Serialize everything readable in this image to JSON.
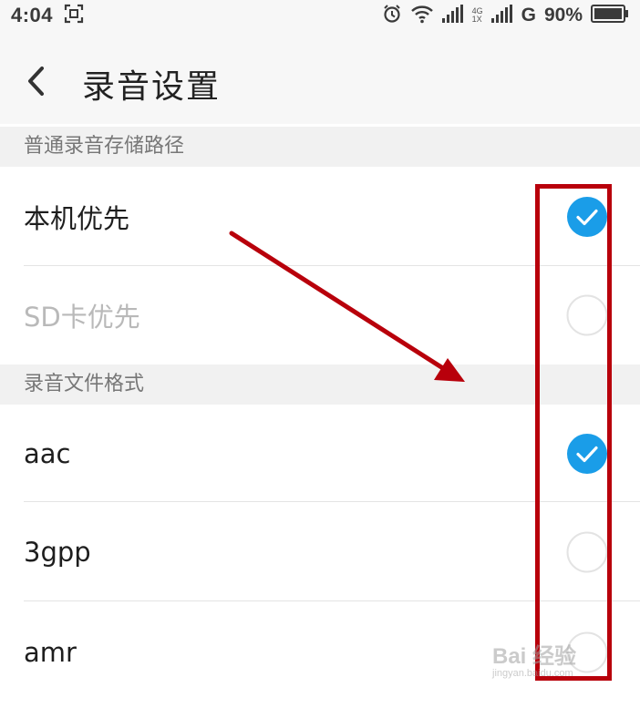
{
  "status_bar": {
    "time": "4:04",
    "network_top": "4G",
    "network_bottom": "1X",
    "carrier": "G",
    "battery": "90%",
    "icons": [
      "screenshot-icon",
      "alarm-icon",
      "wifi-icon",
      "signal-icon",
      "signal-icon",
      "battery-icon"
    ]
  },
  "app_bar": {
    "title": "录音设置",
    "back_icon": "back-arrow-icon"
  },
  "sections": [
    {
      "header": "普通录音存储路径",
      "options": [
        {
          "label": "本机优先",
          "selected": true,
          "enabled": true
        },
        {
          "label": "SD卡优先",
          "selected": false,
          "enabled": false
        }
      ]
    },
    {
      "header": "录音文件格式",
      "options": [
        {
          "label": "aac",
          "selected": true,
          "enabled": true
        },
        {
          "label": "3gpp",
          "selected": false,
          "enabled": true
        },
        {
          "label": "amr",
          "selected": false,
          "enabled": true
        }
      ]
    }
  ],
  "colors": {
    "accent": "#1a9de8",
    "annotation": "#b8000b",
    "header_bg": "#f1f1f1"
  },
  "watermark": {
    "main": "Bai 经验",
    "sub": "jingyan.baidu.com"
  }
}
